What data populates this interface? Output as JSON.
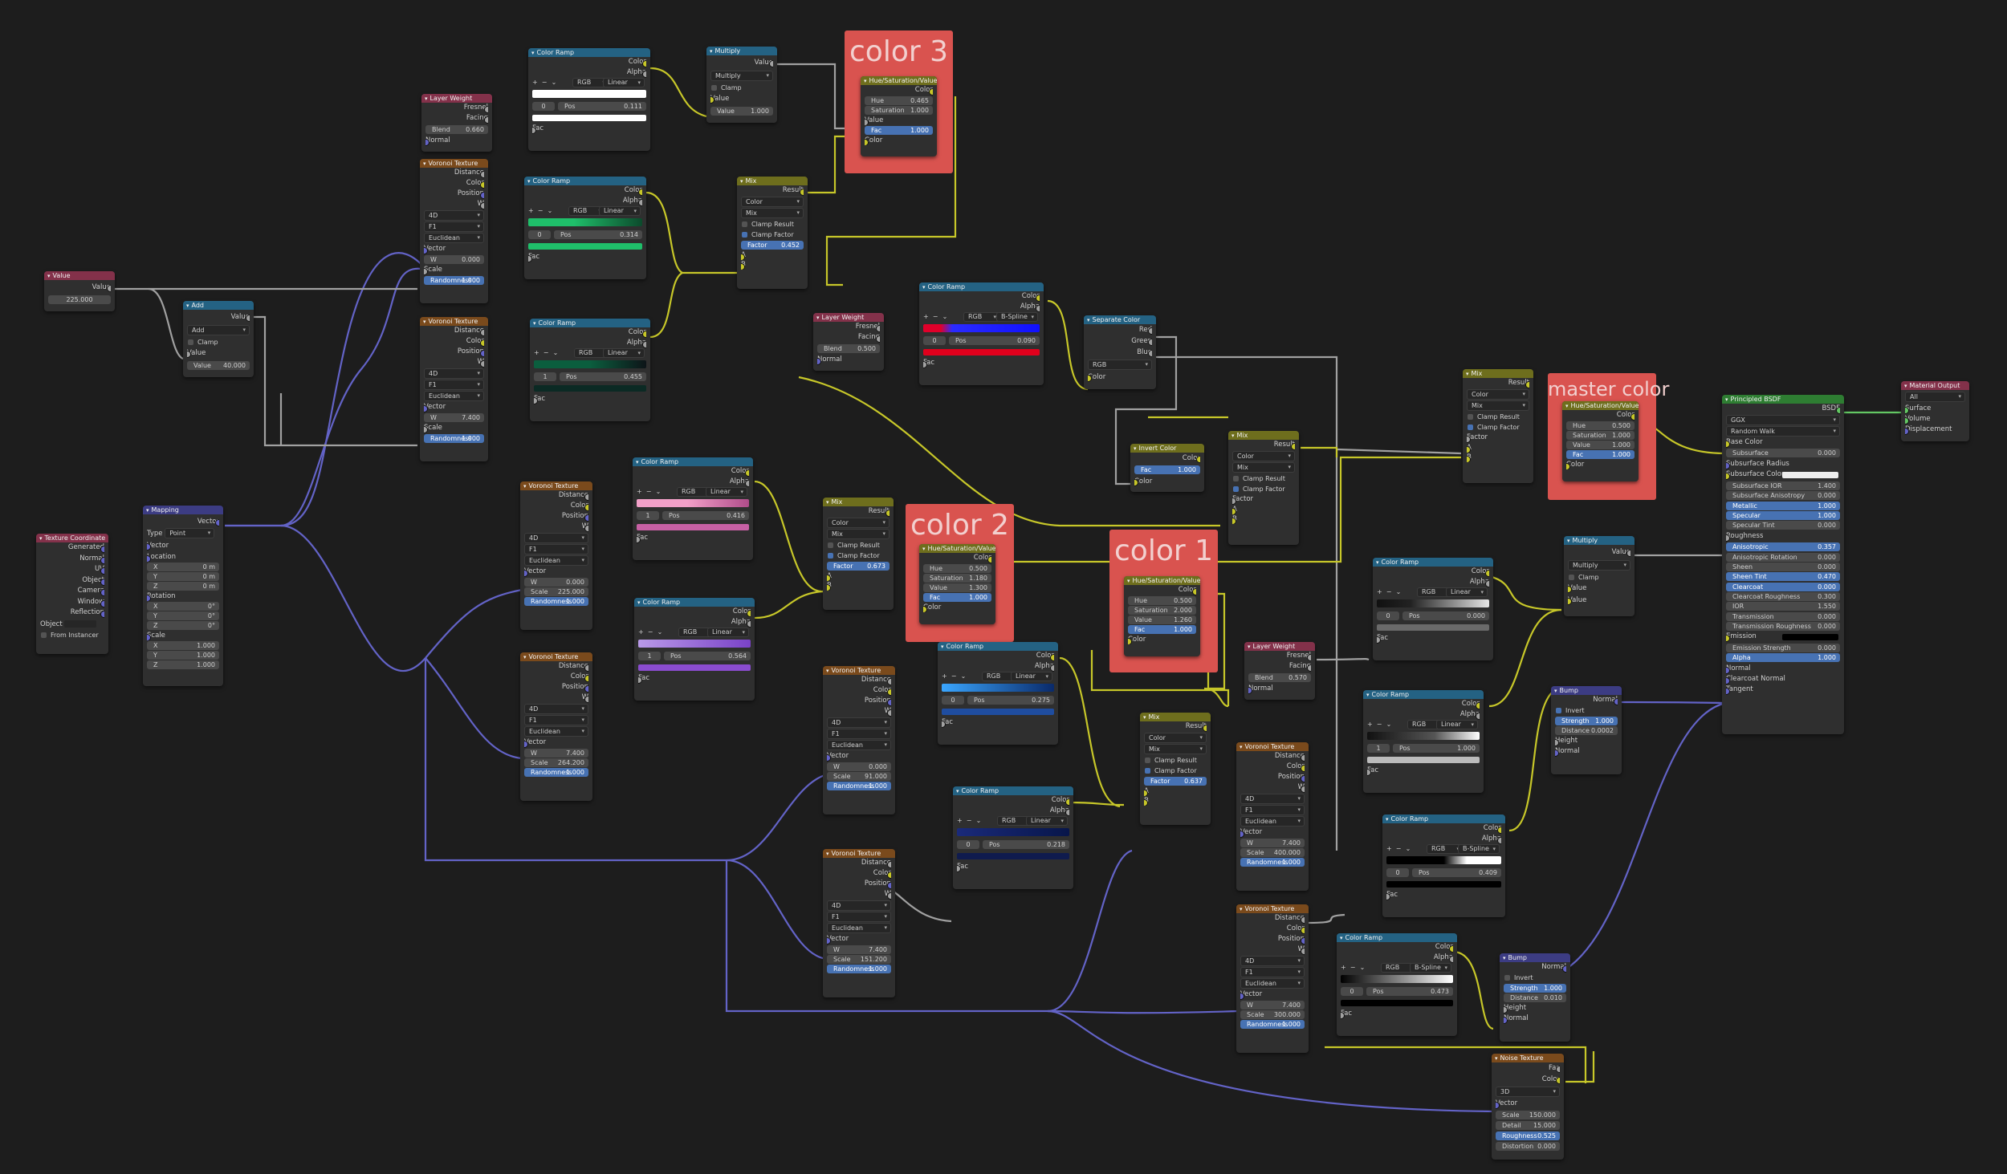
{
  "colors": {
    "shader": "#2e7d32",
    "input": "#83314a",
    "vector": "#3c3c83",
    "texture": "#7a4a1c",
    "converter": "#246283",
    "color": "#6e6e1d",
    "output": "#83314a",
    "frame": "#d9534f"
  },
  "frames": {
    "color3": "color 3",
    "color2": "color 2",
    "color1": "color 1",
    "master": "master color"
  },
  "value_node": {
    "title": "Value",
    "out": "Value",
    "value": "225.000"
  },
  "add_node": {
    "title": "Add",
    "out": "Value",
    "op": "Add",
    "clamp": "Clamp",
    "in1": "Value",
    "in2_k": "Value",
    "in2_v": "40.000"
  },
  "texcoord": {
    "title": "Texture Coordinate",
    "outputs": [
      "Generated",
      "Normal",
      "UV",
      "Object",
      "Camera",
      "Window",
      "Reflection"
    ],
    "object_label": "Object",
    "from_instancer": "From Instancer"
  },
  "mapping": {
    "title": "Mapping",
    "out": "Vector",
    "type_k": "Type",
    "type_v": "Point",
    "vector": "Vector",
    "location": "Location",
    "rotation": "Rotation",
    "scale": "Scale",
    "loc": [
      [
        "X",
        "0 m"
      ],
      [
        "Y",
        "0 m"
      ],
      [
        "Z",
        "0 m"
      ]
    ],
    "rot": [
      [
        "X",
        "0°"
      ],
      [
        "Y",
        "0°"
      ],
      [
        "Z",
        "0°"
      ]
    ],
    "scl": [
      [
        "X",
        "1.000"
      ],
      [
        "Y",
        "1.000"
      ],
      [
        "Z",
        "1.000"
      ]
    ]
  },
  "voronoi_outputs": [
    "Distance",
    "Color",
    "Position",
    "W"
  ],
  "voronoi_inputs": {
    "vector": "Vector",
    "w": "W",
    "scale": "Scale",
    "rand": "Randomness"
  },
  "voronoi_dd": [
    "4D",
    "F1",
    "Euclidean"
  ],
  "voronoi": [
    {
      "title": "Voronoi Texture",
      "w": "0.000",
      "scale": "",
      "rand": "1.000"
    },
    {
      "title": "Voronoi Texture",
      "w": "7.400",
      "scale": "",
      "rand": "1.000"
    },
    {
      "title": "Voronoi Texture",
      "w": "0.000",
      "scale": "225.000",
      "rand": "1.000"
    },
    {
      "title": "Voronoi Texture",
      "w": "7.400",
      "scale": "264.200",
      "rand": "1.000"
    },
    {
      "title": "Voronoi Texture",
      "w": "0.000",
      "scale": "91.000",
      "rand": "1.000"
    },
    {
      "title": "Voronoi Texture",
      "w": "7.400",
      "scale": "151.200",
      "rand": "1.000"
    },
    {
      "title": "Voronoi Texture",
      "w": "7.400",
      "scale": "400.000",
      "rand": "1.000"
    },
    {
      "title": "Voronoi Texture",
      "w": "7.400",
      "scale": "300.000",
      "rand": "1.000"
    }
  ],
  "ramp_outputs": [
    "Color",
    "Alpha"
  ],
  "ramp_fac": "Fac",
  "ramps": [
    {
      "title": "Color Ramp",
      "mode": "RGB",
      "interp": "Linear",
      "idx": "0",
      "pos": "0.111"
    },
    {
      "title": "Color Ramp",
      "mode": "RGB",
      "interp": "Linear",
      "idx": "0",
      "pos": "0.314"
    },
    {
      "title": "Color Ramp",
      "mode": "RGB",
      "interp": "Linear",
      "idx": "1",
      "pos": "0.455"
    },
    {
      "title": "Color Ramp",
      "mode": "RGB",
      "interp": "Linear",
      "idx": "1",
      "pos": "0.416"
    },
    {
      "title": "Color Ramp",
      "mode": "RGB",
      "interp": "Linear",
      "idx": "1",
      "pos": "0.564"
    },
    {
      "title": "Color Ramp",
      "mode": "RGB",
      "interp": "B-Spline",
      "idx": "0",
      "pos": "0.090"
    },
    {
      "title": "Color Ramp",
      "mode": "RGB",
      "interp": "Linear",
      "idx": "0",
      "pos": "0.275"
    },
    {
      "title": "Color Ramp",
      "mode": "RGB",
      "interp": "Linear",
      "idx": "0",
      "pos": "0.218"
    },
    {
      "title": "Color Ramp",
      "mode": "RGB",
      "interp": "Linear",
      "idx": "0",
      "pos": "0.000"
    },
    {
      "title": "Color Ramp",
      "mode": "RGB",
      "interp": "Linear",
      "idx": "1",
      "pos": "1.000"
    },
    {
      "title": "Color Ramp",
      "mode": "RGB",
      "interp": "B-Spline",
      "idx": "0",
      "pos": "0.409"
    },
    {
      "title": "Color Ramp",
      "mode": "RGB",
      "interp": "B-Spline",
      "idx": "0",
      "pos": "0.473"
    }
  ],
  "layer_weight": {
    "title": "Layer Weight",
    "outputs": [
      "Fresnel",
      "Facing"
    ],
    "blend_k": "Blend",
    "normal": "Normal",
    "blends": [
      "0.660",
      "0.500",
      "0.570"
    ]
  },
  "multiply": {
    "title": "Multiply",
    "out": "Value",
    "op": "Multiply",
    "clamp": "Clamp",
    "in": "Value",
    "val1": "1.000"
  },
  "mix_common": {
    "title": "Mix",
    "out": "Result",
    "dd1": "Color",
    "dd2": "Mix",
    "clamp_result": "Clamp Result",
    "clamp_factor": "Clamp Factor",
    "factor": "Factor",
    "a": "A",
    "b": "B"
  },
  "mix_factors": [
    "0.452",
    "0.673",
    "0.637"
  ],
  "hsv": {
    "title": "Hue/Saturation/Value",
    "out": "Color",
    "hue": "Hue",
    "sat": "Saturation",
    "val": "Value",
    "fac": "Fac",
    "color": "Color",
    "c3": [
      "0.465",
      "1.000",
      "",
      "1.000"
    ],
    "c2": [
      "0.500",
      "1.180",
      "1.300",
      "1.000"
    ],
    "c1": [
      "0.500",
      "2.000",
      "1.260",
      "1.000"
    ],
    "master": [
      "0.500",
      "1.000",
      "1.000",
      "1.000"
    ],
    "c3_value": "Value"
  },
  "separate": {
    "title": "Separate Color",
    "outputs": [
      "Red",
      "Green",
      "Blue"
    ],
    "mode": "RGB",
    "color": "Color"
  },
  "invert": {
    "title": "Invert Color",
    "out": "Color",
    "fac_k": "Fac",
    "fac_v": "1.000",
    "color": "Color"
  },
  "bump": {
    "title": "Bump",
    "out": "Normal",
    "invert": "Invert",
    "strength": "Strength",
    "distance": "Distance",
    "height": "Height",
    "normal": "Normal",
    "b1": [
      "1.000",
      "0.0002"
    ],
    "b2": [
      "1.000",
      "0.010"
    ]
  },
  "noise": {
    "title": "Noise Texture",
    "outputs": [
      "Fac",
      "Color"
    ],
    "dim": "3D",
    "vector": "Vector",
    "rows": [
      [
        "Scale",
        "150.000"
      ],
      [
        "Detail",
        "15.000"
      ],
      [
        "Roughness",
        "0.525"
      ],
      [
        "Distortion",
        "0.000"
      ]
    ]
  },
  "bsdf": {
    "title": "Principled BSDF",
    "out": "BSDF",
    "dd": [
      "GGX",
      "Random Walk"
    ],
    "base": "Base Color",
    "rows": [
      [
        "Subsurface",
        "0.000",
        ""
      ],
      [
        "Subsurface Radius",
        "",
        ""
      ],
      [
        "Subsurface Color",
        "",
        ""
      ],
      [
        "Subsurface IOR",
        "1.400",
        ""
      ],
      [
        "Subsurface Anisotropy",
        "0.000",
        ""
      ],
      [
        "Metallic",
        "1.000",
        "b"
      ],
      [
        "Specular",
        "1.000",
        "b"
      ],
      [
        "Specular Tint",
        "0.000",
        ""
      ],
      [
        "Roughness",
        "",
        ""
      ],
      [
        "Anisotropic",
        "0.357",
        "b"
      ],
      [
        "Anisotropic Rotation",
        "0.000",
        ""
      ],
      [
        "Sheen",
        "0.000",
        ""
      ],
      [
        "Sheen Tint",
        "0.470",
        "b"
      ],
      [
        "Clearcoat",
        "0.000",
        "b"
      ],
      [
        "Clearcoat Roughness",
        "0.300",
        ""
      ],
      [
        "IOR",
        "1.550",
        ""
      ],
      [
        "Transmission",
        "0.000",
        ""
      ],
      [
        "Transmission Roughness",
        "0.000",
        ""
      ],
      [
        "Emission",
        "",
        ""
      ],
      [
        "Emission Strength",
        "0.000",
        ""
      ],
      [
        "Alpha",
        "1.000",
        "b"
      ]
    ],
    "tail": [
      "Normal",
      "Clearcoat Normal",
      "Tangent"
    ]
  },
  "matout": {
    "title": "Material Output",
    "dd": "All",
    "inputs": [
      "Surface",
      "Volume",
      "Displacement"
    ]
  }
}
